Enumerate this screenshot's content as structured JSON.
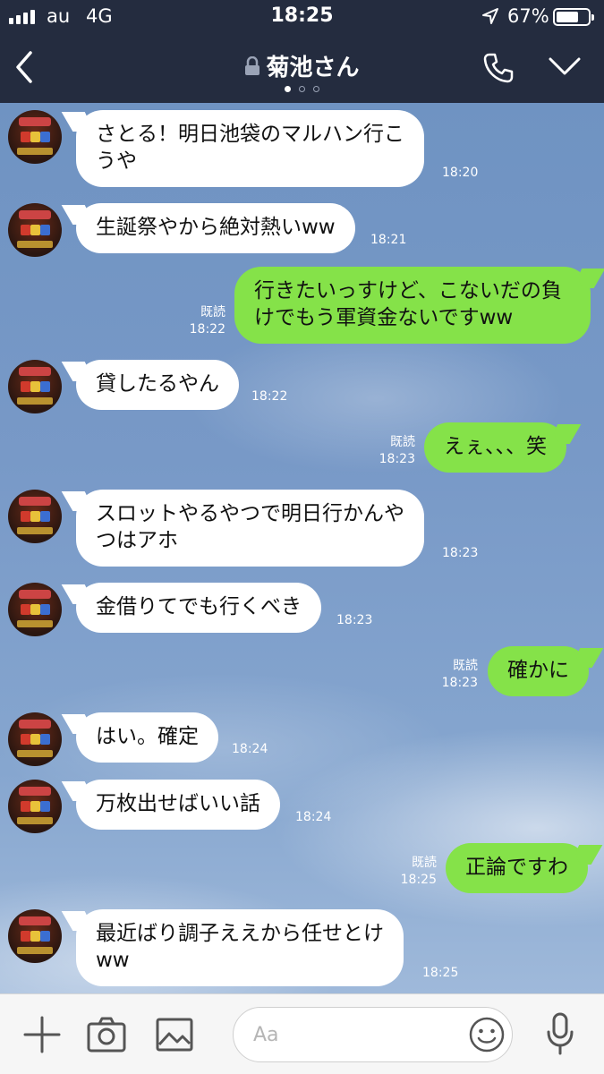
{
  "status_bar": {
    "carrier": "au",
    "network": "4G",
    "time": "18:25",
    "battery": "67%"
  },
  "header": {
    "title": "菊池さん",
    "page_dots": 3,
    "active_dot": 0
  },
  "messages": [
    {
      "side": "in",
      "lines": [
        "さとる！明日池袋のマルハン行こ",
        "うや"
      ],
      "time": "18:20",
      "read": ""
    },
    {
      "side": "in",
      "lines": [
        "生誕祭やから絶対熱いww"
      ],
      "time": "18:21",
      "read": ""
    },
    {
      "side": "out",
      "lines": [
        "行きたいっすけど、こないだの負",
        "けでもう軍資金ないですww"
      ],
      "time": "18:22",
      "read": "既読"
    },
    {
      "side": "in",
      "lines": [
        "貸したるやん"
      ],
      "time": "18:22",
      "read": ""
    },
    {
      "side": "out",
      "lines": [
        "えぇ、、、笑"
      ],
      "time": "18:23",
      "read": "既読"
    },
    {
      "side": "in",
      "lines": [
        "スロットやるやつで明日行かんや",
        "つはアホ"
      ],
      "time": "18:23",
      "read": ""
    },
    {
      "side": "in",
      "lines": [
        "金借りてでも行くべき"
      ],
      "time": "18:23",
      "read": ""
    },
    {
      "side": "out",
      "lines": [
        "確かに"
      ],
      "time": "18:23",
      "read": "既読"
    },
    {
      "side": "in",
      "lines": [
        "はい。確定"
      ],
      "time": "18:24",
      "read": ""
    },
    {
      "side": "in",
      "lines": [
        "万枚出せばいい話"
      ],
      "time": "18:24",
      "read": ""
    },
    {
      "side": "out",
      "lines": [
        "正論ですわ"
      ],
      "time": "18:25",
      "read": "既読"
    },
    {
      "side": "in",
      "lines": [
        "最近ばり調子ええから任せとけ",
        "ww"
      ],
      "time": "18:25",
      "read": ""
    }
  ],
  "input": {
    "placeholder": "Aa",
    "value": ""
  },
  "icons": {
    "back": "chevron-left-icon",
    "lock": "lock-icon",
    "call": "phone-icon",
    "menu": "chevron-down-icon",
    "plus": "plus-icon",
    "camera": "camera-icon",
    "image": "image-icon",
    "emoji": "emoji-icon",
    "mic": "microphone-icon"
  },
  "colors": {
    "header_bg": "#242c3f",
    "outgoing_bubble": "#85e249",
    "incoming_bubble": "#ffffff",
    "chat_bg": "#7a9cc8"
  }
}
